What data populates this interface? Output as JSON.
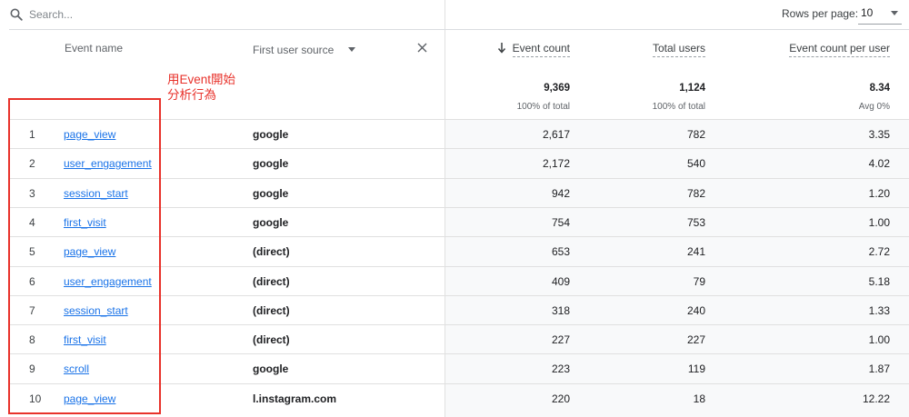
{
  "search": {
    "placeholder": "Search..."
  },
  "pagination": {
    "rows_label": "Rows per page:",
    "rows_value": "10"
  },
  "headers": {
    "event_name": "Event name",
    "first_user_source": "First user source",
    "event_count": "Event count",
    "total_users": "Total users",
    "event_count_per_user": "Event count per user"
  },
  "totals": {
    "event_count": "9,369",
    "event_count_sub": "100% of total",
    "total_users": "1,124",
    "total_users_sub": "100% of total",
    "per_user": "8.34",
    "per_user_sub": "Avg 0%"
  },
  "annotation": {
    "line1": "用Event開始",
    "line2": "分析行為",
    "color": "#e8322b"
  },
  "rows": [
    {
      "index": "1",
      "event": "page_view",
      "source": "google",
      "event_count": "2,617",
      "total_users": "782",
      "per_user": "3.35"
    },
    {
      "index": "2",
      "event": "user_engagement",
      "source": "google",
      "event_count": "2,172",
      "total_users": "540",
      "per_user": "4.02"
    },
    {
      "index": "3",
      "event": "session_start",
      "source": "google",
      "event_count": "942",
      "total_users": "782",
      "per_user": "1.20"
    },
    {
      "index": "4",
      "event": "first_visit",
      "source": "google",
      "event_count": "754",
      "total_users": "753",
      "per_user": "1.00"
    },
    {
      "index": "5",
      "event": "page_view",
      "source": "(direct)",
      "event_count": "653",
      "total_users": "241",
      "per_user": "2.72"
    },
    {
      "index": "6",
      "event": "user_engagement",
      "source": "(direct)",
      "event_count": "409",
      "total_users": "79",
      "per_user": "5.18"
    },
    {
      "index": "7",
      "event": "session_start",
      "source": "(direct)",
      "event_count": "318",
      "total_users": "240",
      "per_user": "1.33"
    },
    {
      "index": "8",
      "event": "first_visit",
      "source": "(direct)",
      "event_count": "227",
      "total_users": "227",
      "per_user": "1.00"
    },
    {
      "index": "9",
      "event": "scroll",
      "source": "google",
      "event_count": "223",
      "total_users": "119",
      "per_user": "1.87"
    },
    {
      "index": "10",
      "event": "page_view",
      "source": "l.instagram.com",
      "event_count": "220",
      "total_users": "18",
      "per_user": "12.22"
    }
  ],
  "colors": {
    "link": "#1a73e8",
    "annotation": "#e8322b",
    "metric_background": "#f8f9fa"
  }
}
